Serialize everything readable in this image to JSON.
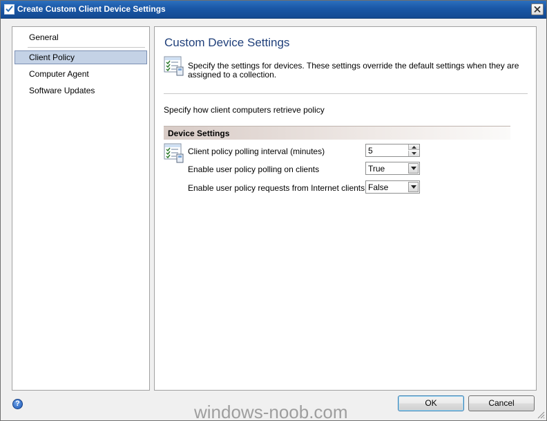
{
  "window": {
    "title": "Create Custom Client Device Settings"
  },
  "nav": {
    "items": [
      {
        "label": "General",
        "selected": false
      },
      {
        "label": "Client Policy",
        "selected": true
      },
      {
        "label": "Computer Agent",
        "selected": false
      },
      {
        "label": "Software Updates",
        "selected": false
      }
    ]
  },
  "content": {
    "title": "Custom Device Settings",
    "description": "Specify the settings for devices. These settings override the default settings when they are assigned to a collection.",
    "intro": "Specify how client computers retrieve policy",
    "section_title": "Device Settings",
    "settings": [
      {
        "label": "Client policy polling interval (minutes)",
        "value": "5",
        "control": "spinner"
      },
      {
        "label": "Enable user policy polling on clients",
        "value": "True",
        "control": "dropdown"
      },
      {
        "label": "Enable user policy requests from Internet clients",
        "value": "False",
        "control": "dropdown"
      }
    ]
  },
  "footer": {
    "ok_label": "OK",
    "cancel_label": "Cancel",
    "watermark": "windows-noob.com"
  },
  "icons": {
    "window": "settings-checklist-icon",
    "close": "close-icon",
    "help": "help-icon",
    "page": "checklist-settings-icon"
  },
  "colors": {
    "titlebar": "#1a57a6",
    "page_title": "#1f3f7a",
    "selected_nav": "#c4d2e6"
  }
}
